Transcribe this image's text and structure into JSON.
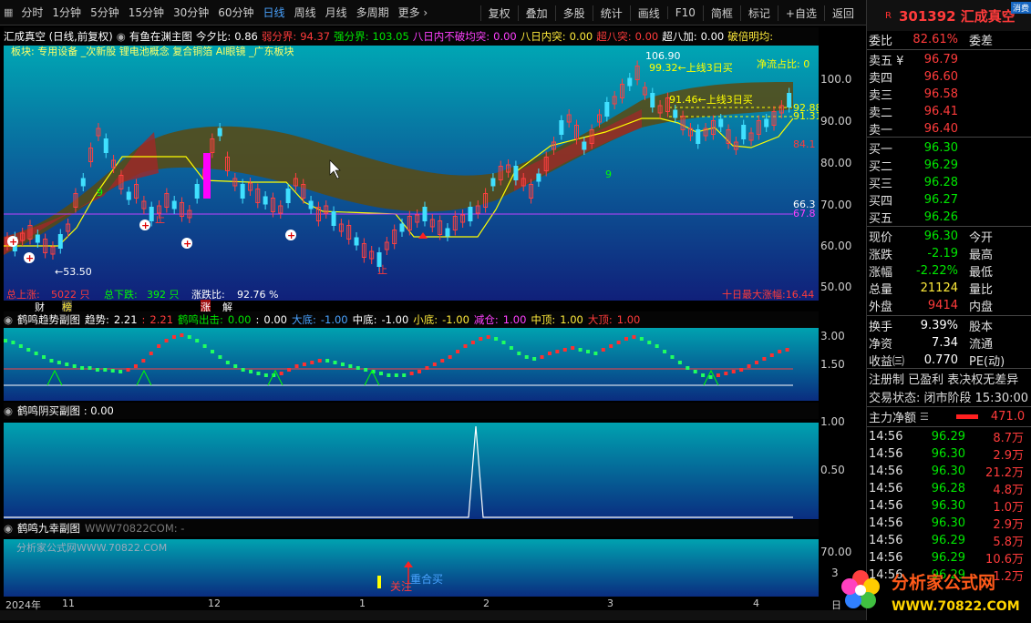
{
  "toolbar": {
    "items": [
      "分时",
      "1分钟",
      "5分钟",
      "15分钟",
      "30分钟",
      "60分钟",
      "日线",
      "周线",
      "月线",
      "多周期",
      "更多 ›"
    ],
    "active": "日线",
    "right_items": [
      "复权",
      "叠加",
      "多股",
      "统计",
      "画线",
      "F10",
      "简框",
      "标记",
      "+自选",
      "返回"
    ]
  },
  "stock": {
    "r_badge": "R",
    "title": "301392 汇成真空",
    "corner_tag": "消费"
  },
  "infobar": {
    "name": "汇成真空 (日线,前复权)",
    "indicator": "有鱼在渊主图",
    "jinxi_label": "今夕比:",
    "jinxi_val": "0.86",
    "ruofen_label": "弱分界:",
    "ruofen_val": "94.37",
    "qiangfen_label": "强分界:",
    "qiangfen_val": "103.05",
    "badiu_label": "八日内不破均突:",
    "badiu_val": "0.00",
    "bari_label": "八日内突:",
    "bari_val": "0.00",
    "chaobatu_label": "超八突:",
    "chaobatu_val": "0.00",
    "chaobajia_label": "超八加:",
    "chaobajia_val": "0.00",
    "pobei_label": "破倍明均:"
  },
  "mainchart": {
    "sector": "板块:    专用设备 _次新股 锂电池概念 复合铜箔 AI眼镜 _广东板块",
    "high_label": "106.90",
    "ann1": "99.32←上线3日买",
    "ann2": "91.46←上线3日买",
    "jingliu": "净流占比: 0",
    "low_label": "←53.50",
    "zhi1": "止",
    "zhi2": "止",
    "nine1": "9",
    "nine2": "9",
    "right_levels": [
      "92.88",
      "91.31",
      "84.1",
      "66.3",
      "67.8"
    ],
    "stats_up_label": "总上涨:",
    "stats_up_val": "5022 只",
    "stats_down_label": "总下跌:",
    "stats_down_val": "392 只",
    "stats_ratio_label": "涨跌比:",
    "stats_ratio_val": "92.76 %",
    "stats_right": "十日最大涨幅:16.44",
    "bottom_tags": [
      "财",
      "榜",
      "涨",
      "解"
    ],
    "yaxis": [
      "100.0",
      "90.00",
      "80.00",
      "70.00",
      "60.00",
      "50.00"
    ]
  },
  "panel1": {
    "title": "鹤鸣趋势副图",
    "fields": [
      {
        "label": "趋势:",
        "val": "2.21"
      },
      {
        "label": ":",
        "val": "2.21"
      },
      {
        "label": "鹤鸣出击:",
        "val": "0.00"
      },
      {
        "label": ":",
        "val": "0.00"
      },
      {
        "label": "大底:",
        "val": "-1.00"
      },
      {
        "label": "中底:",
        "val": "-1.00"
      },
      {
        "label": "小底:",
        "val": "-1.00"
      },
      {
        "label": "减仓:",
        "val": "1.00"
      },
      {
        "label": "中顶:",
        "val": "1.00"
      },
      {
        "label": "大顶:",
        "val": "1.00"
      }
    ],
    "yaxis": [
      "3.00",
      "1.50"
    ]
  },
  "panel2": {
    "title": "鹤鸣阴买副图 : 0.00",
    "yaxis": [
      "1.00",
      "0.50"
    ]
  },
  "panel3": {
    "title": "鹤鸣九幸副图",
    "watermark1": "WWW70822COM: -",
    "watermark2": "分析家公式网WWW.70822.COM",
    "guanzhu": "关注",
    "chonghe": "重合买",
    "yaxis": [
      "70.00",
      "3"
    ]
  },
  "timeaxis": [
    "2024年",
    "11",
    "12",
    "1",
    "2",
    "3",
    "4"
  ],
  "timeaxis_right": "日",
  "quote": {
    "weibi_label": "委比",
    "weibi_val": "82.61%",
    "weicha_label": "委差",
    "asks": [
      {
        "label": "卖五 ¥",
        "price": "96.79"
      },
      {
        "label": "卖四",
        "price": "96.60"
      },
      {
        "label": "卖三",
        "price": "96.58"
      },
      {
        "label": "卖二",
        "price": "96.41"
      },
      {
        "label": "卖一",
        "price": "96.40"
      }
    ],
    "bids": [
      {
        "label": "买一",
        "price": "96.30"
      },
      {
        "label": "买二",
        "price": "96.29"
      },
      {
        "label": "买三",
        "price": "96.28"
      },
      {
        "label": "买四",
        "price": "96.27"
      },
      {
        "label": "买五",
        "price": "96.26"
      }
    ],
    "stats": [
      {
        "l": "现价",
        "v": "96.30",
        "r": "今开",
        "c": "green"
      },
      {
        "l": "涨跌",
        "v": "-2.19",
        "r": "最高",
        "c": "green"
      },
      {
        "l": "涨幅",
        "v": "-2.22%",
        "r": "最低",
        "c": "green"
      },
      {
        "l": "总量",
        "v": "21124",
        "r": "量比",
        "c": "yellow"
      },
      {
        "l": "外盘",
        "v": "9414",
        "r": "内盘",
        "c": "red"
      }
    ],
    "stats2": [
      {
        "l": "换手",
        "v": "9.39%",
        "r": "股本"
      },
      {
        "l": "净资",
        "v": "7.34",
        "r": "流通"
      },
      {
        "l": "收益㈢",
        "v": "0.770",
        "r": "PE(动)"
      }
    ],
    "reg_line": "注册制 已盈利 表决权无差异",
    "trade_status": "交易状态: 闭市阶段 15:30:00",
    "main_flow_label": "主力净额",
    "main_flow_val": "471.0",
    "ticks": [
      {
        "t": "14:56",
        "p": "96.29",
        "v": "8.7万"
      },
      {
        "t": "14:56",
        "p": "96.30",
        "v": "2.9万"
      },
      {
        "t": "14:56",
        "p": "96.30",
        "v": "21.2万"
      },
      {
        "t": "14:56",
        "p": "96.28",
        "v": "4.8万"
      },
      {
        "t": "14:56",
        "p": "96.30",
        "v": "1.0万"
      },
      {
        "t": "14:56",
        "p": "96.30",
        "v": "2.9万"
      },
      {
        "t": "14:56",
        "p": "96.29",
        "v": "5.8万"
      },
      {
        "t": "14:56",
        "p": "96.29",
        "v": "10.6万"
      },
      {
        "t": "14:56",
        "p": "96.29",
        "v": "1.2万"
      }
    ]
  },
  "logo": {
    "name": "分析家公式网",
    "url": "WWW.70822.COM"
  }
}
